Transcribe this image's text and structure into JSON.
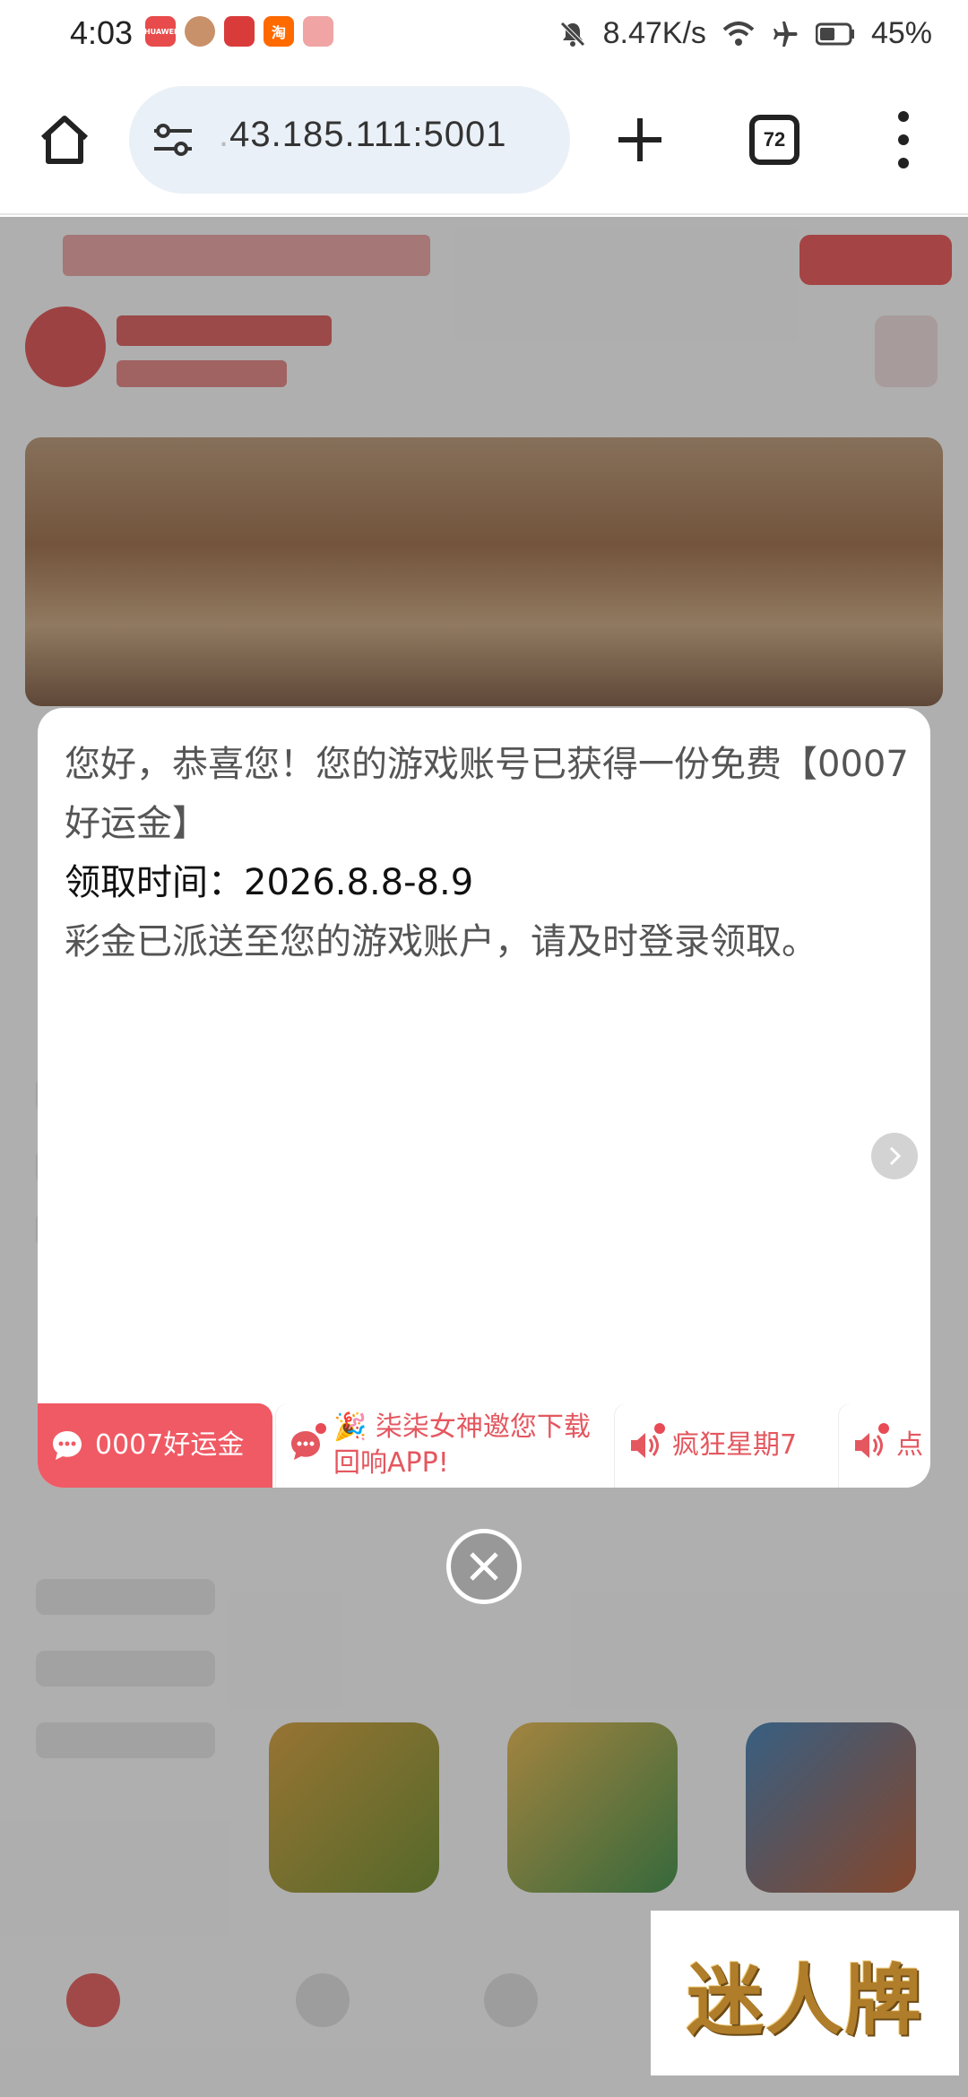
{
  "status_bar": {
    "time": "4:03",
    "app_icons": [
      {
        "name": "huawei-app",
        "label": "HUAWEI",
        "color": "#e84b4b"
      },
      {
        "name": "avatar-app",
        "label": "",
        "color": "#c9916a"
      },
      {
        "name": "game-app",
        "label": "",
        "color": "#d93b3b"
      },
      {
        "name": "taobao-app",
        "label": "淘",
        "color": "#ff6a00"
      },
      {
        "name": "mall-app",
        "label": "",
        "color": "#f0a4a4"
      }
    ],
    "network_speed": "8.47K/s",
    "battery": "45%"
  },
  "browser": {
    "url": "43.185.111:5001",
    "tab_count": "72"
  },
  "dialog": {
    "message_line1": "您好，恭喜您！您的游戏账号已获得一份免费【0007好运金】",
    "claim_time": "领取时间：2026.8.8-8.9",
    "message_line3": "彩金已派送至您的游戏账户，请及时登录领取。",
    "tabs": [
      {
        "label": "0007好运金",
        "icon": "chat-bubble-icon",
        "active": true
      },
      {
        "label": "🎉 柒柒女神邀您下载回响APP!",
        "icon": "chat-bubble-icon",
        "active": false
      },
      {
        "label": "疯狂星期7",
        "icon": "speaker-icon",
        "active": false
      },
      {
        "label": "点",
        "icon": "speaker-icon",
        "active": false
      }
    ]
  },
  "watermark": {
    "text": "迷人牌"
  },
  "colors": {
    "accent": "#f05a64",
    "accent_text": "#e4575f"
  }
}
